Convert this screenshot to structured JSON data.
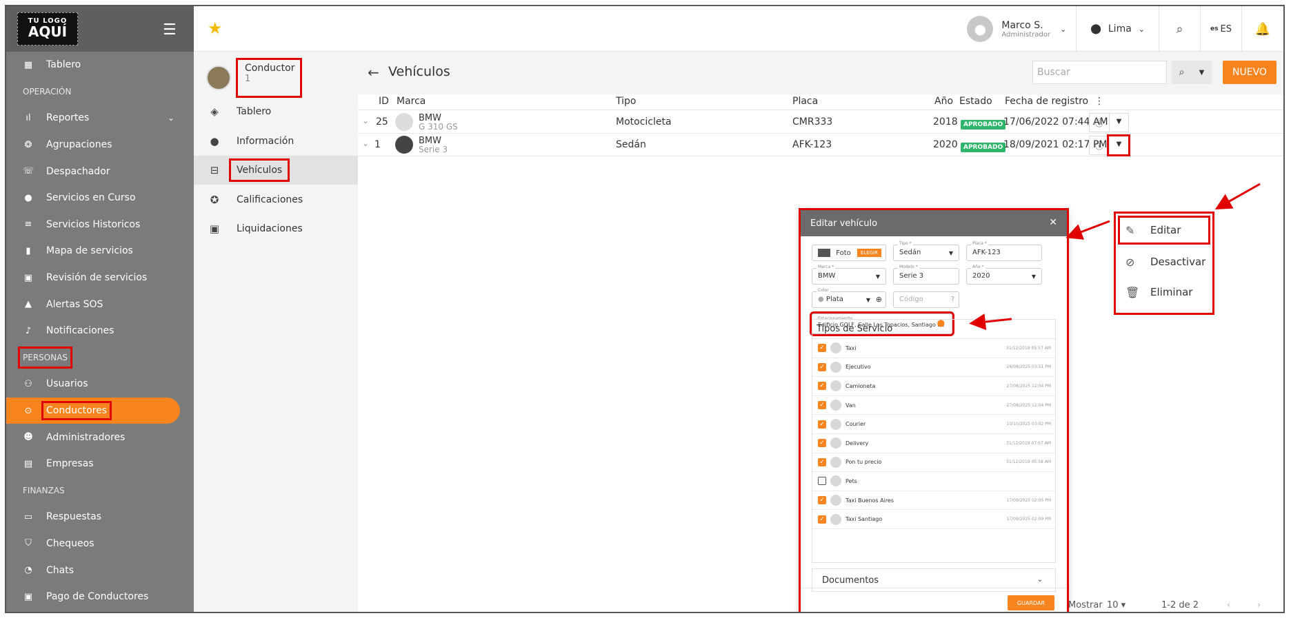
{
  "logo": {
    "line1": "TU LOGO",
    "line2": "AQUÍ"
  },
  "sidebar": {
    "items": [
      {
        "label": "Tablero",
        "icon": "dashboard-icon"
      },
      {
        "section": "OPERACIÓN"
      },
      {
        "label": "Reportes",
        "icon": "chart-icon"
      },
      {
        "label": "Agrupaciones",
        "icon": "group-icon"
      },
      {
        "label": "Despachador",
        "icon": "phone-icon"
      },
      {
        "label": "Servicios en Curso",
        "icon": "dot-icon"
      },
      {
        "label": "Servicios Historicos",
        "icon": "list-icon"
      },
      {
        "label": "Mapa de servicios",
        "icon": "map-icon"
      },
      {
        "label": "Revisión de servicios",
        "icon": "review-icon"
      },
      {
        "label": "Alertas SOS",
        "icon": "warning-icon"
      },
      {
        "label": "Notificaciones",
        "icon": "bell-icon"
      },
      {
        "section": "PERSONAS"
      },
      {
        "label": "Usuarios",
        "icon": "users-icon"
      },
      {
        "label": "Conductores",
        "icon": "driver-icon"
      },
      {
        "label": "Administradores",
        "icon": "admin-icon"
      },
      {
        "label": "Empresas",
        "icon": "building-icon"
      },
      {
        "section": "FINANZAS"
      },
      {
        "label": "Respuestas",
        "icon": "reply-icon"
      },
      {
        "label": "Chequeos",
        "icon": "shield-icon"
      },
      {
        "label": "Chats",
        "icon": "chat-icon"
      },
      {
        "label": "Pago de Conductores",
        "icon": "payment-icon"
      }
    ]
  },
  "topbar": {
    "user_name": "Marco S.",
    "user_role": "Administrador",
    "city": "Lima",
    "lang": "ES",
    "lang_prefix": "es"
  },
  "driver": {
    "label": "Conductor",
    "number": "1"
  },
  "subnav": [
    {
      "label": "Tablero",
      "icon": "layers-icon"
    },
    {
      "label": "Información",
      "icon": "person-icon"
    },
    {
      "label": "Vehículos",
      "icon": "car-icon"
    },
    {
      "label": "Calificaciones",
      "icon": "star-icon"
    },
    {
      "label": "Liquidaciones",
      "icon": "wallet-icon"
    }
  ],
  "page": {
    "title": "Vehículos",
    "search_placeholder": "Buscar",
    "new_label": "NUEVO"
  },
  "table": {
    "headers": [
      "ID",
      "Marca",
      "Tipo",
      "Placa",
      "Año",
      "Estado",
      "Fecha de registro"
    ],
    "rows": [
      {
        "id": "25",
        "brand": "BMW",
        "model": "G 310 GS",
        "type": "Motocicleta",
        "plate": "CMR333",
        "year": "2018",
        "status": "APROBADO",
        "date": "17/06/2022 07:44 AM"
      },
      {
        "id": "1",
        "brand": "BMW",
        "model": "Serie 3",
        "type": "Sedán",
        "plate": "AFK-123",
        "year": "2020",
        "status": "APROBADO",
        "date": "18/09/2021 02:17 PM"
      }
    ]
  },
  "modal": {
    "title": "Editar vehículo",
    "photo_label": "Foto",
    "choose_label": "ELEGIR",
    "tipo_label": "Tipo *",
    "tipo": "Sedán",
    "placa_label": "Placa *",
    "placa": "AFK-123",
    "marca_label": "Marca *",
    "marca": "BMW",
    "modelo_label": "Modelo *",
    "modelo": "Serie 3",
    "anio_label": "Año *",
    "anio": "2020",
    "color_label": "Color",
    "color": "Plata",
    "codigo_placeholder": "Código",
    "estac_label": "Estacionamiento",
    "estac": "Edificio GOLF, Calle Los Topacios, Santiago de",
    "tipos_title": "Tipos de Servicio",
    "tipos": [
      {
        "name": "Taxi",
        "date": "31/12/2019 05:57 AM",
        "checked": true
      },
      {
        "name": "Ejecutivo",
        "date": "26/08/2025 03:51 PM",
        "checked": true
      },
      {
        "name": "Camioneta",
        "date": "27/08/2025 12:04 PM",
        "checked": true
      },
      {
        "name": "Van",
        "date": "27/08/2025 12:04 PM",
        "checked": true
      },
      {
        "name": "Courier",
        "date": "10/10/2025 03:02 PM",
        "checked": true
      },
      {
        "name": "Delivery",
        "date": "31/12/2019 07:57 AM",
        "checked": true
      },
      {
        "name": "Pon tu precio",
        "date": "31/12/2019 05:58 AM",
        "checked": true
      },
      {
        "name": "Pets",
        "date": "",
        "checked": false
      },
      {
        "name": "Taxi Buenos Aires",
        "date": "17/09/2025 02:05 PM",
        "checked": true
      },
      {
        "name": "Taxi Santiago",
        "date": "17/09/2025 02:09 PM",
        "checked": true
      }
    ],
    "docs_label": "Documentos",
    "save_label": "GUARDAR"
  },
  "popup": {
    "edit": "Editar",
    "disable": "Desactivar",
    "delete": "Eliminar"
  },
  "pager": {
    "show_label": "Mostrar",
    "page_size": "10",
    "range": "1-2 de 2"
  },
  "colors": {
    "accent": "#f7841f",
    "sidebar": "#7b7b7b",
    "approved": "#2db66b",
    "highlight": "#e00000"
  }
}
